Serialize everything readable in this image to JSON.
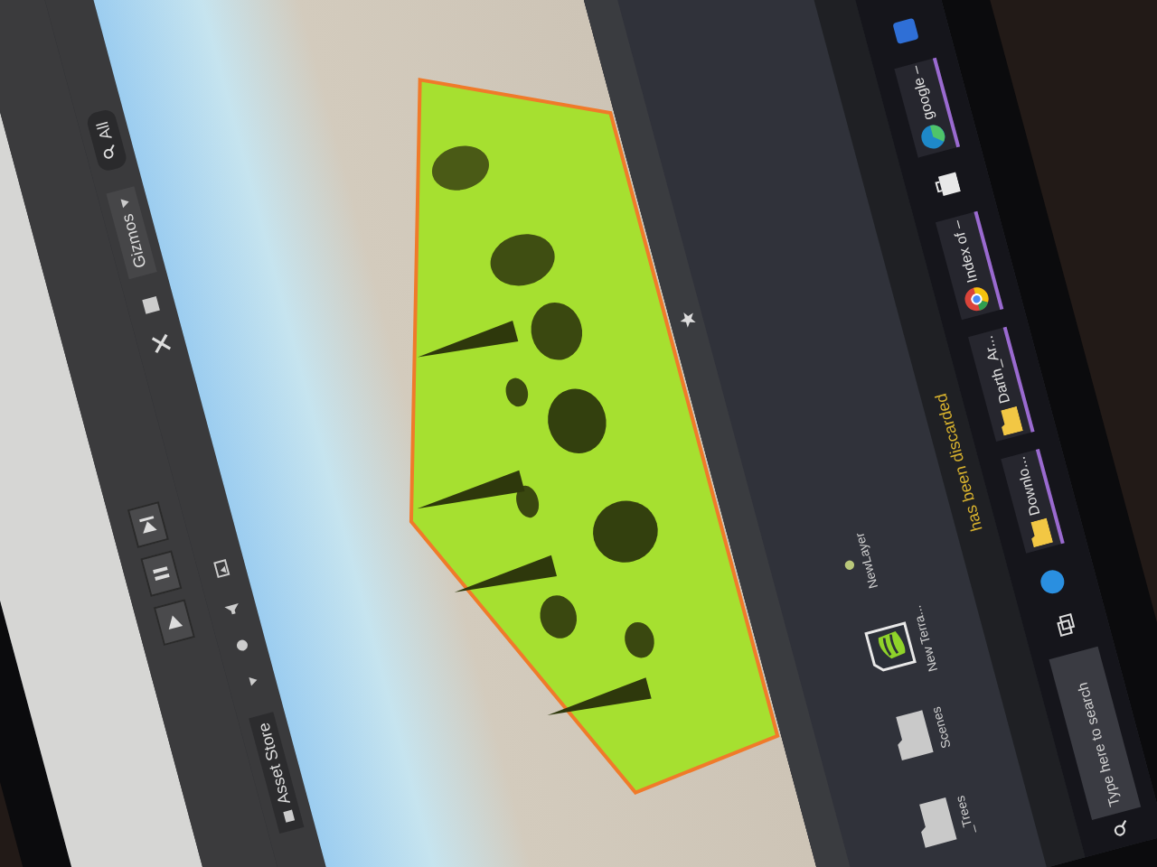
{
  "main_toolbar": {
    "play_controls": [
      {
        "kind": "play"
      },
      {
        "kind": "pause"
      },
      {
        "kind": "step"
      }
    ]
  },
  "scene_toolbar": {
    "tab": "Asset Store",
    "gizmos": "Gizmos",
    "search_value": "All"
  },
  "project": {
    "assets": [
      {
        "name": "_Trees",
        "kind": "folder"
      },
      {
        "name": "Scenes",
        "kind": "folder"
      },
      {
        "name": "New Terra...",
        "kind": "terrain"
      },
      {
        "name": "NewLayer",
        "kind": "layer"
      }
    ]
  },
  "status_bar": {
    "message": "has been discarded"
  },
  "taskbar": {
    "search": {
      "placeholder": "Type here to search"
    },
    "apps": [
      {
        "kind": "circle"
      },
      {
        "kind": "folder",
        "label": "Downlo..."
      },
      {
        "kind": "folder",
        "label": "Darth_Ar..."
      },
      {
        "kind": "browser",
        "label": "Index of –"
      },
      {
        "kind": "bag"
      },
      {
        "kind": "edge",
        "label": "google –"
      },
      {
        "kind": "square"
      }
    ]
  }
}
